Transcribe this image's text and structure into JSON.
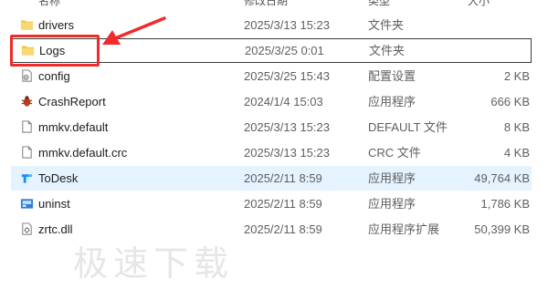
{
  "header": {
    "name": "名称",
    "date": "修改日期",
    "type": "类型",
    "size": "大小"
  },
  "files": [
    {
      "name": "drivers",
      "date": "2025/3/13 15:23",
      "type": "文件夹",
      "size": "",
      "icon": "folder-icon"
    },
    {
      "name": "Logs",
      "date": "2025/3/25 0:01",
      "type": "文件夹",
      "size": "",
      "icon": "folder-icon"
    },
    {
      "name": "config",
      "date": "2025/3/25 15:43",
      "type": "配置设置",
      "size": "2 KB",
      "icon": "config-file-icon"
    },
    {
      "name": "CrashReport",
      "date": "2024/1/4 15:03",
      "type": "应用程序",
      "size": "666 KB",
      "icon": "crash-report-icon"
    },
    {
      "name": "mmkv.default",
      "date": "2025/3/13 15:23",
      "type": "DEFAULT 文件",
      "size": "8 KB",
      "icon": "file-icon"
    },
    {
      "name": "mmkv.default.crc",
      "date": "2025/3/13 15:23",
      "type": "CRC 文件",
      "size": "4 KB",
      "icon": "file-icon"
    },
    {
      "name": "ToDesk",
      "date": "2025/2/11 8:59",
      "type": "应用程序",
      "size": "49,764 KB",
      "icon": "todesk-icon"
    },
    {
      "name": "uninst",
      "date": "2025/2/11 8:59",
      "type": "应用程序",
      "size": "1,786 KB",
      "icon": "uninstaller-icon"
    },
    {
      "name": "zrtc.dll",
      "date": "2025/2/11 8:59",
      "type": "应用程序扩展",
      "size": "50,399 KB",
      "icon": "dll-file-icon"
    }
  ],
  "watermark": "极速下载",
  "colors": {
    "annotation": "#ef2b2b",
    "selection": "#e5f3ff",
    "folder": "#f3c443"
  }
}
